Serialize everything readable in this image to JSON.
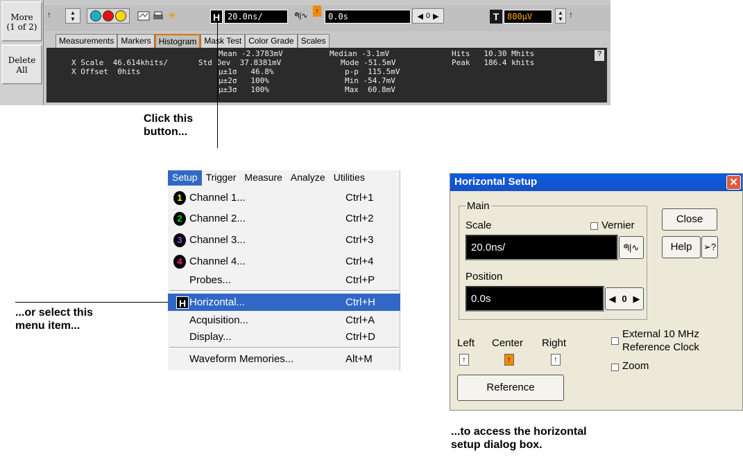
{
  "toolbar": {
    "more_label": "More",
    "more_sub": "(1 of 2)",
    "delete_label": "Delete",
    "delete_sub": "All",
    "horizontal_badge": "H",
    "time_scale": "20.0ns/",
    "time_position": "0.0s",
    "position_zero": "0",
    "trigger_badge": "T",
    "trigger_level": "800µV"
  },
  "tabs": [
    "Measurements",
    "Markers",
    "Histogram",
    "Mask Test",
    "Color Grade",
    "Scales"
  ],
  "stats": {
    "x_scale": "X Scale  46.614khits/",
    "x_offset": "X Offset  0hits",
    "mean": "Mean -2.3783mV",
    "std_dev": "Std Dev  37.8381mV",
    "s1": "µ±1σ   46.8%",
    "s2": "µ±2σ   100%",
    "s3": "µ±3σ   100%",
    "median": "Median -3.1mV",
    "mode": "Mode -51.5mV",
    "pp": "p-p  115.5mV",
    "min": "Min -54.7mV",
    "max": "Max  60.8mV",
    "hits": "Hits   10.30 Mhits",
    "peak": "Peak   186.4 khits",
    "help": "?"
  },
  "callouts": {
    "click_1": "Click this",
    "click_2": "button...",
    "select_1": "...or select this",
    "select_2": "menu item...",
    "access_1": "...to access the horizontal",
    "access_2": "setup dialog box."
  },
  "menu": {
    "bar": [
      "Setup",
      "Trigger",
      "Measure",
      "Analyze",
      "Utilities"
    ],
    "items": [
      {
        "chip": "1",
        "label": "Channel 1...",
        "shortcut": "Ctrl+1"
      },
      {
        "chip": "2",
        "label": "Channel 2...",
        "shortcut": "Ctrl+2"
      },
      {
        "chip": "3",
        "label": "Channel 3...",
        "shortcut": "Ctrl+3"
      },
      {
        "chip": "4",
        "label": "Channel 4...",
        "shortcut": "Ctrl+4"
      },
      {
        "label": "Probes...",
        "shortcut": "Ctrl+P"
      },
      {
        "chip": "H",
        "label": "Horizontal...",
        "shortcut": "Ctrl+H"
      },
      {
        "label": "Acquisition...",
        "shortcut": "Ctrl+A"
      },
      {
        "label": "Display...",
        "shortcut": "Ctrl+D"
      },
      {
        "label": "Waveform Memories...",
        "shortcut": "Alt+M"
      }
    ]
  },
  "dialog": {
    "title": "Horizontal Setup",
    "close_x": "✕",
    "main_group": "Main",
    "scale_label": "Scale",
    "vernier_label": "Vernier",
    "scale_value": "20.0ns/",
    "position_label": "Position",
    "position_value": "0.0s",
    "position_zero": "0",
    "close_button": "Close",
    "help_button": "Help",
    "ext_clock_1": "External 10 MHz",
    "ext_clock_2": "Reference Clock",
    "zoom_label": "Zoom",
    "left_label": "Left",
    "center_label": "Center",
    "right_label": "Right",
    "reference_button": "Reference"
  },
  "colors": {
    "accent_orange": "#f08a00",
    "menu_highlight": "#3168c5",
    "titlebar_blue": "#0a5ddf",
    "channel_1": "#ffff00",
    "channel_2": "#00e000",
    "channel_3": "#a040ff",
    "channel_4": "#ff2090"
  }
}
